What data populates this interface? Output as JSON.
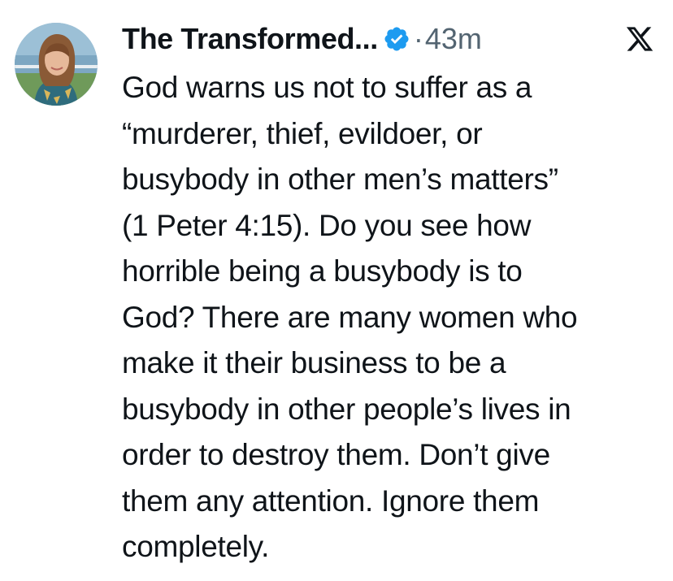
{
  "tweet": {
    "author_name": "The Transformed...",
    "verified": true,
    "separator": "·",
    "timestamp": "43m",
    "platform_icon": "x-logo-icon",
    "avatar_icon": "profile-photo",
    "text_lines": [
      "God warns us not to suffer as a",
      "“murderer, thief, evildoer, or",
      "busybody in other men’s matters”",
      "(1 Peter 4:15). Do you see how",
      "horrible being a busybody is to",
      "God? There are many women who",
      "make it their business to be a",
      "busybody in other people’s lives in",
      "order to destroy them. Don’t give",
      "them any attention. Ignore them",
      "completely."
    ]
  },
  "colors": {
    "text": "#0f1419",
    "secondary_text": "#536471",
    "verified_badge": "#1d9bf0",
    "background": "#ffffff"
  }
}
